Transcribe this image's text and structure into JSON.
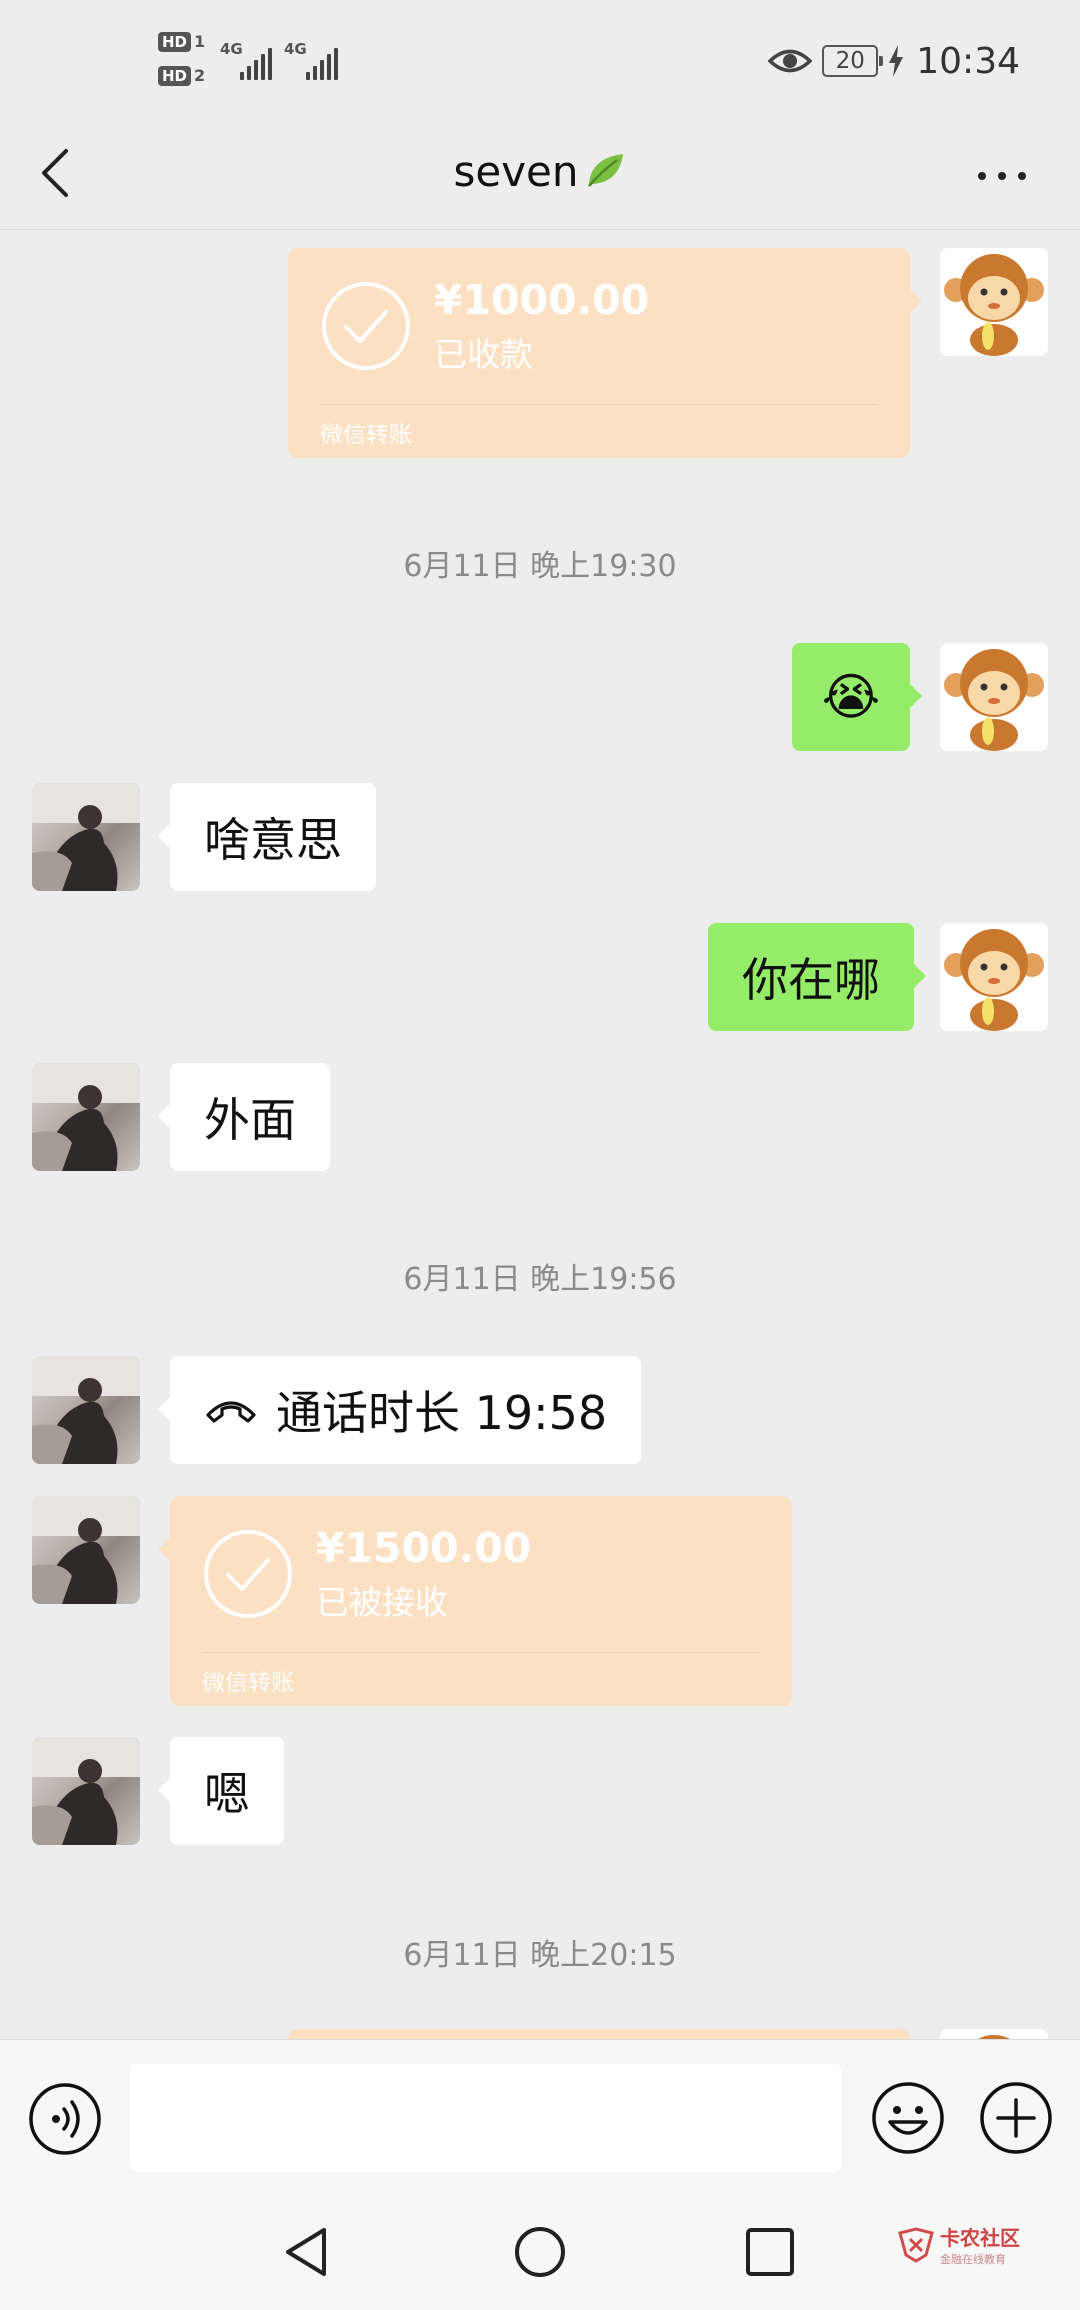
{
  "status_bar": {
    "hd1": "HD",
    "hd1_num": "1",
    "hd2": "HD",
    "hd2_num": "2",
    "net1": "4G",
    "net2": "4G",
    "battery": "20",
    "time": "10:34",
    "icons": [
      "eye-icon",
      "battery-icon",
      "charging-bolt-icon",
      "signal-icon"
    ]
  },
  "nav": {
    "title": "seven",
    "back_icon": "chevron-left-icon",
    "more_icon": "more-dots-icon"
  },
  "messages": {
    "transfer_1": {
      "amount": "¥1000.00",
      "status": "已收款",
      "label": "微信转账"
    },
    "time_1": "6月11日 晚上19:30",
    "emoji_reply": "😭",
    "msg_1": "啥意思",
    "msg_2": "你在哪",
    "msg_3": "外面",
    "time_2": "6月11日 晚上19:56",
    "call": {
      "text": "通话时长 19:58"
    },
    "transfer_2": {
      "amount": "¥1500.00",
      "status": "已被接收",
      "label": "微信转账"
    },
    "msg_4": "嗯",
    "time_3": "6月11日 晚上20:15"
  },
  "input_bar": {
    "placeholder": "",
    "icons": [
      "voice-icon",
      "emoji-icon",
      "plus-icon"
    ]
  },
  "watermark": {
    "title": "卡农社区",
    "subtitle": "金融在线教育"
  },
  "colors": {
    "background": "#ededed",
    "sent_bubble": "#95ec69",
    "received_bubble": "#ffffff",
    "transfer_card": "#fce0c3"
  }
}
